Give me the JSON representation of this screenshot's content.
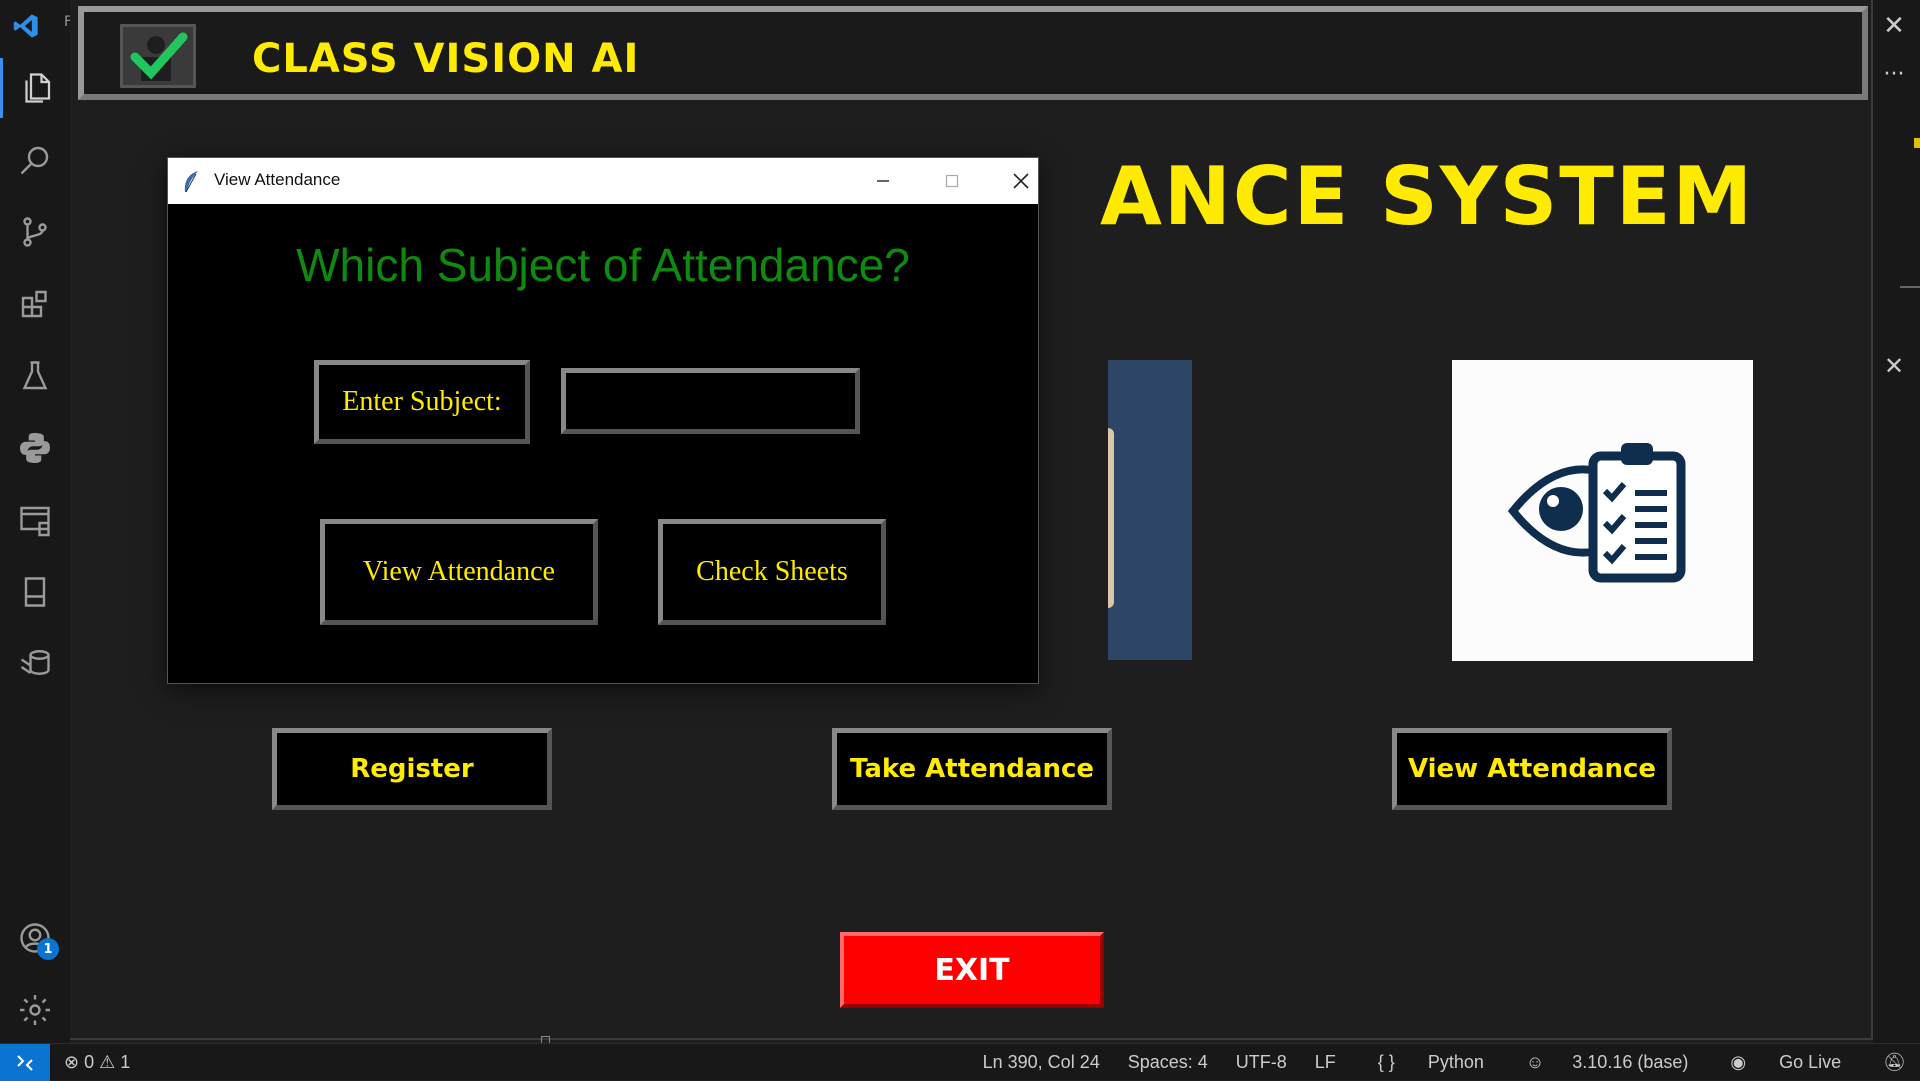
{
  "vscode": {
    "title_fragment": "F",
    "account_badge": "1"
  },
  "app": {
    "title": "CLASS VISION AI",
    "heading_visible": "ANCE SYSTEM",
    "buttons": {
      "register": "Register",
      "take_attendance": "Take Attendance",
      "view_attendance": "View Attendance",
      "exit": "EXIT"
    }
  },
  "dialog": {
    "title": "View Attendance",
    "question": "Which Subject of Attendance?",
    "subject_label": "Enter Subject:",
    "subject_value": "",
    "view_button": "View Attendance",
    "check_sheets_button": "Check Sheets"
  },
  "status_bar": {
    "errors": "0",
    "warnings": "1",
    "position": "Ln 390, Col 24",
    "spaces": "Spaces: 4",
    "encoding": "UTF-8",
    "eol": "LF",
    "language": "Python",
    "interpreter": "3.10.16 (base)",
    "go_live": "Go Live"
  },
  "colors": {
    "accent_yellow": "#ffeb00",
    "dialog_green": "#0e8a0e",
    "exit_red": "#ff0000",
    "vscode_blue": "#0a74d0"
  }
}
